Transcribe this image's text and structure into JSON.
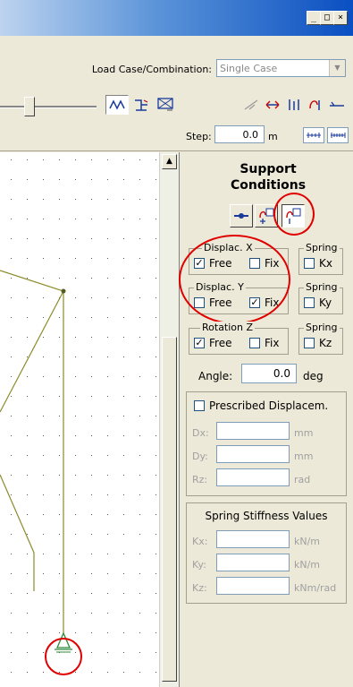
{
  "window": {
    "minimize_glyph": "_",
    "maximize_glyph": "□",
    "close_glyph": "×"
  },
  "load_case": {
    "label": "Load Case/Combination:",
    "value": "Single Case"
  },
  "step": {
    "label": "Step:",
    "value": "0.0",
    "unit": "m"
  },
  "support_panel": {
    "title_line1": "Support",
    "title_line2": "Conditions",
    "displac_x": {
      "title": "Displac. X",
      "free_label": "Free",
      "free_checked": "✓",
      "fix_label": "Fix",
      "fix_checked": ""
    },
    "displac_y": {
      "title": "Displac. Y",
      "free_label": "Free",
      "free_checked": "",
      "fix_label": "Fix",
      "fix_checked": "✓"
    },
    "rotation_z": {
      "title": "Rotation Z",
      "free_label": "Free",
      "free_checked": "✓",
      "fix_label": "Fix",
      "fix_checked": ""
    },
    "spring_x": {
      "title": "Spring",
      "label": "Kx",
      "checked": ""
    },
    "spring_y": {
      "title": "Spring",
      "label": "Ky",
      "checked": ""
    },
    "spring_z": {
      "title": "Spring",
      "label": "Kz",
      "checked": ""
    },
    "angle": {
      "label": "Angle:",
      "value": "0.0",
      "unit": "deg"
    },
    "prescribed": {
      "label": "Prescribed Displacem.",
      "checked": "",
      "rows": [
        {
          "label": "Dx:",
          "value": "",
          "unit": "mm"
        },
        {
          "label": "Dy:",
          "value": "",
          "unit": "mm"
        },
        {
          "label": "Rz:",
          "value": "",
          "unit": "rad"
        }
      ]
    },
    "spring_stiffness": {
      "title": "Spring Stiffness Values",
      "rows": [
        {
          "label": "Kx:",
          "value": "",
          "unit": "kN/m"
        },
        {
          "label": "Ky:",
          "value": "",
          "unit": "kN/m"
        },
        {
          "label": "Kz:",
          "value": "",
          "unit": "kNm/rad"
        }
      ]
    }
  },
  "colors": {
    "highlight": "#e00000",
    "member_line": "#8b8b2a",
    "support_green": "#2e8b3a"
  }
}
